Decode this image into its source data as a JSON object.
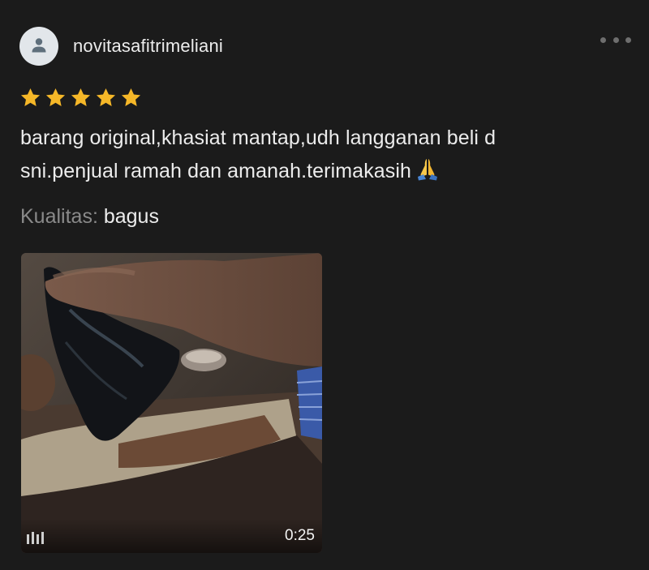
{
  "review": {
    "username": "novitasafitrimeliani",
    "rating": 5,
    "rating_max": 5,
    "text_lines": [
      "barang original,khasiat mantap,udh langganan beli d",
      "sni.penjual ramah dan amanah.terimakasih"
    ],
    "emoji_icon": "folded-hands-icon",
    "quality_label": "Kualitas:",
    "quality_value": "bagus",
    "video": {
      "duration": "0:25",
      "icon": "video-camera-icon"
    },
    "avatar_icon": "user-icon",
    "more_icon": "more-options-icon"
  },
  "colors": {
    "background": "#1b1b1b",
    "star": "#f5b728",
    "text": "#ececec",
    "muted": "#8a8a8a"
  }
}
